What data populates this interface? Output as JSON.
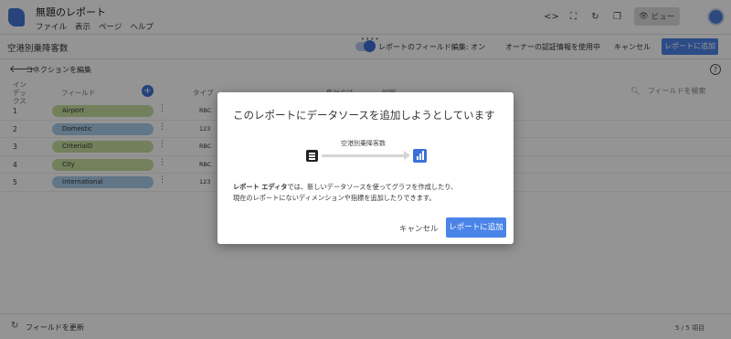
{
  "app": {
    "title": "無題のレポート",
    "menu": [
      "ファイル",
      "表示",
      "ページ",
      "ヘルプ"
    ],
    "view_button": "ビュー"
  },
  "toolbar": {
    "datasource_name": "空港別乗降客数",
    "field_edit_label": "レポートのフィールド編集: オン",
    "owner_credentials": "オーナーの認証情報を使用中",
    "cancel": "キャンセル",
    "add_to_report": "レポートに追加"
  },
  "editor": {
    "edit_connection": "コネクションを編集",
    "columns": {
      "index": "インデックス",
      "field": "フィールド",
      "type": "タイプ",
      "aggregation": "集計方法",
      "description": "説明"
    },
    "search_placeholder": "フィールドを検索",
    "rows": [
      {
        "index": "1",
        "field": "Airport",
        "kind": "dimension",
        "type": "RBC"
      },
      {
        "index": "2",
        "field": "Domestic",
        "kind": "metric",
        "type": "123"
      },
      {
        "index": "3",
        "field": "CriteriaID",
        "kind": "dimension",
        "type": "RBC"
      },
      {
        "index": "4",
        "field": "City",
        "kind": "dimension",
        "type": "RBC"
      },
      {
        "index": "5",
        "field": "International",
        "kind": "metric",
        "type": "123"
      }
    ],
    "refresh_fields": "フィールドを更新",
    "item_count": "5 / 5 項目"
  },
  "modal": {
    "title": "このレポートにデータソースを追加しようとしています",
    "datasource_label": "空港別乗降客数",
    "body_bold": "レポート エディタ",
    "body_line1_rest": "では、新しいデータソースを使ってグラフを作成したり、",
    "body_line2": "現在のレポートにないディメンションや指標を追加したりできます。",
    "cancel": "キャンセル",
    "add": "レポートに追加"
  },
  "colors": {
    "accent": "#4a84e8",
    "dimension_pill": "#c7dd9f",
    "metric_pill": "#a8cbe9"
  },
  "icons": [
    "report-logo-icon",
    "code-icon",
    "fullscreen-icon",
    "refresh-icon",
    "copy-icon",
    "eye-icon",
    "back-arrow-icon",
    "help-icon",
    "plus-icon",
    "search-icon",
    "kebab-icon",
    "table-icon",
    "bar-chart-icon"
  ]
}
